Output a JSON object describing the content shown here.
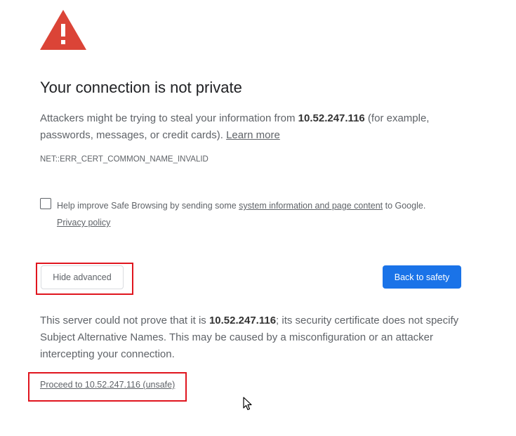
{
  "page": {
    "title": "Your connection is not private",
    "intro_prefix": "Attackers might be trying to steal your information from ",
    "host": "10.52.247.116",
    "intro_suffix": " (for example, passwords, messages, or credit cards). ",
    "learn_more": "Learn more",
    "error_code": "NET::ERR_CERT_COMMON_NAME_INVALID"
  },
  "optin": {
    "checked": false,
    "prefix": "Help improve Safe Browsing by sending some ",
    "link": "system information and page content",
    "suffix": " to Google.",
    "privacy_link": "Privacy policy"
  },
  "buttons": {
    "hide_advanced": "Hide advanced",
    "back_to_safety": "Back to safety"
  },
  "details": {
    "prefix": "This server could not prove that it is ",
    "host": "10.52.247.116",
    "suffix": "; its security certificate does not specify Subject Alternative Names. This may be caused by a misconfiguration or an attacker intercepting your connection."
  },
  "proceed_link": "Proceed to 10.52.247.116 (unsafe)",
  "colors": {
    "accent": "#1a73e8",
    "warning_icon": "#d93025",
    "highlight_box": "#e0151e"
  },
  "icons": {
    "warning": "warning-triangle-icon",
    "cursor": "mouse-cursor-icon"
  }
}
